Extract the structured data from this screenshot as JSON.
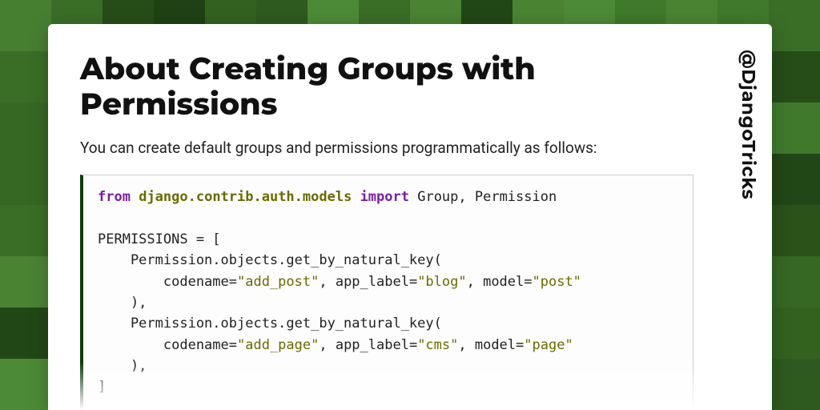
{
  "handle": "@DjangoTricks",
  "title": "About Creating Groups with Permissions",
  "intro": "You can create default groups and permissions programmatically as follows:",
  "code": {
    "tokens": [
      {
        "t": "kw",
        "v": "from"
      },
      {
        "t": "",
        "v": " "
      },
      {
        "t": "mod",
        "v": "django.contrib.auth.models"
      },
      {
        "t": "",
        "v": " "
      },
      {
        "t": "kw",
        "v": "import"
      },
      {
        "t": "",
        "v": " Group, Permission\n\nPERMISSIONS = [\n    Permission.objects.get_by_natural_key(\n        codename="
      },
      {
        "t": "str",
        "v": "\"add_post\""
      },
      {
        "t": "",
        "v": ", app_label="
      },
      {
        "t": "str",
        "v": "\"blog\""
      },
      {
        "t": "",
        "v": ", model="
      },
      {
        "t": "str",
        "v": "\"post\""
      },
      {
        "t": "",
        "v": "\n    ),\n    Permission.objects.get_by_natural_key(\n        codename="
      },
      {
        "t": "str",
        "v": "\"add_page\""
      },
      {
        "t": "",
        "v": ", app_label="
      },
      {
        "t": "str",
        "v": "\"cms\""
      },
      {
        "t": "",
        "v": ", model="
      },
      {
        "t": "str",
        "v": "\"page\""
      },
      {
        "t": "",
        "v": "\n    ),\n]"
      }
    ]
  },
  "checker_palette": [
    "#2e5a1f",
    "#3a6e27",
    "#1f4214",
    "#477f31",
    "#33621f",
    "#4d8a36",
    "#264d18",
    "#3f7a2c",
    "#2a5219",
    "#366824",
    "#4a8433",
    "#224716"
  ]
}
